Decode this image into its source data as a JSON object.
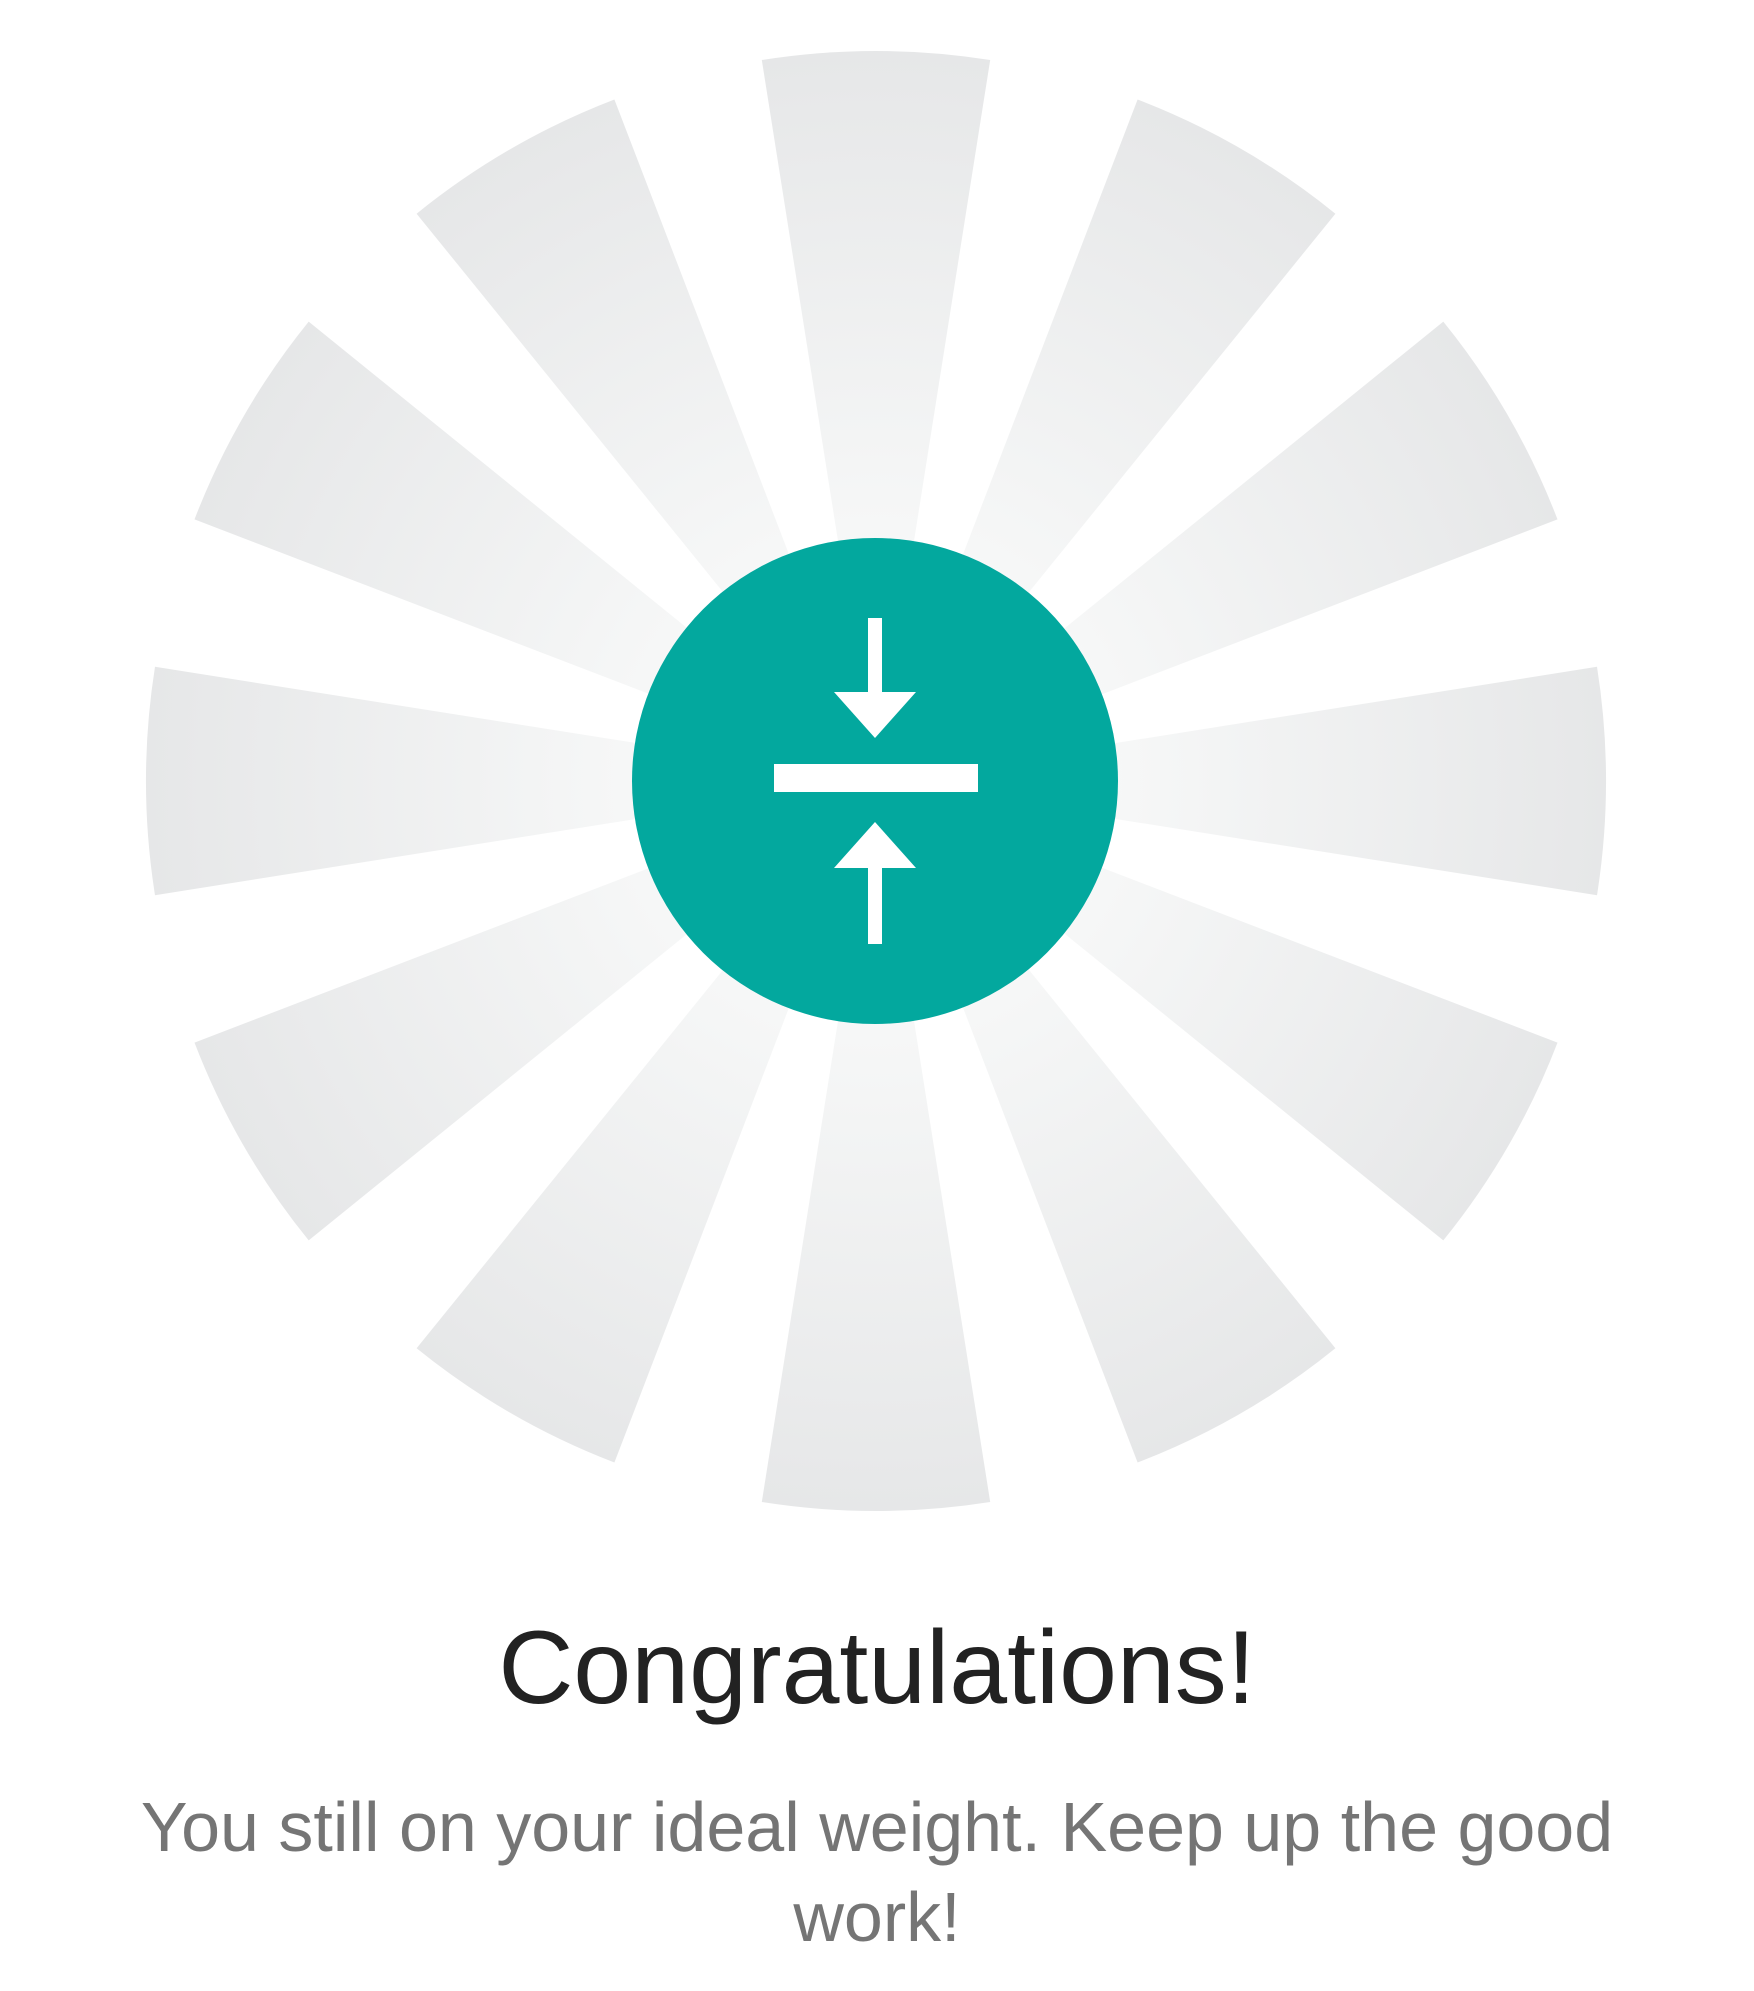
{
  "result": {
    "icon": "compress-arrows-icon",
    "title": "Congratulations!",
    "message": "You still on your ideal weight. Keep up the good work!"
  },
  "colors": {
    "accent": "#03a89e",
    "ray": "#e8e9ea",
    "title": "#222222",
    "message": "#757575",
    "background": "#ffffff"
  }
}
